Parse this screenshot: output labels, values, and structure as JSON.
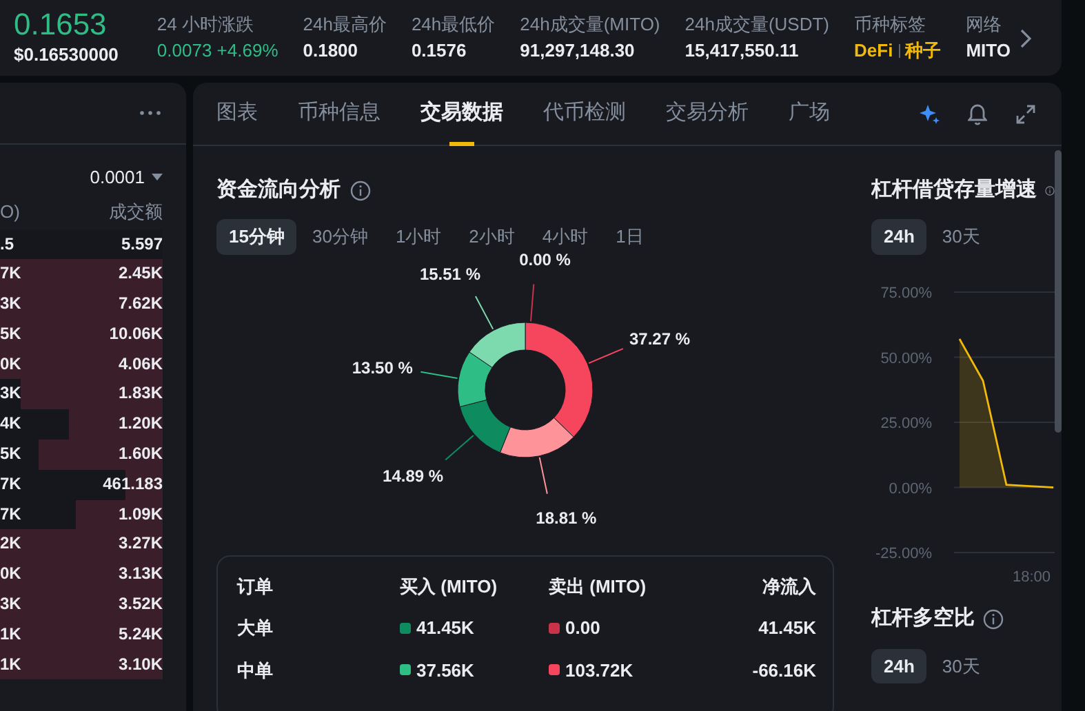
{
  "ticker": {
    "price": "0.1653",
    "price_usd": "$0.16530000"
  },
  "stats": [
    {
      "label": "24 小时涨跌",
      "value": "0.0073 +4.69%",
      "kind": "change"
    },
    {
      "label": "24h最高价",
      "value": "0.1800",
      "kind": "plain"
    },
    {
      "label": "24h最低价",
      "value": "0.1576",
      "kind": "plain"
    },
    {
      "label": "24h成交量(MITO)",
      "value": "91,297,148.30",
      "kind": "plain"
    },
    {
      "label": "24h成交量(USDT)",
      "value": "15,417,550.11",
      "kind": "plain"
    },
    {
      "label": "币种标签",
      "tags": [
        "DeFi",
        "种子"
      ],
      "kind": "tags"
    },
    {
      "label": "网络",
      "value": "MITO",
      "kind": "plain"
    }
  ],
  "order_book": {
    "precision": "0.0001",
    "columns": [
      "O)",
      "成交额"
    ],
    "rows": [
      {
        "amount": ".5",
        "total": "5.597",
        "level": 0
      },
      {
        "amount": "7K",
        "total": "2.45K",
        "level": 1
      },
      {
        "amount": "3K",
        "total": "7.62K",
        "level": 1
      },
      {
        "amount": "5K",
        "total": "10.06K",
        "level": 1
      },
      {
        "amount": "0K",
        "total": "4.06K",
        "level": 1
      },
      {
        "amount": "3K",
        "total": "1.83K",
        "level": 0.87
      },
      {
        "amount": "4K",
        "total": "1.20K",
        "level": 0.58
      },
      {
        "amount": "5K",
        "total": "1.60K",
        "level": 0.76
      },
      {
        "amount": "7K",
        "total": "461.183",
        "level": 0.23
      },
      {
        "amount": "7K",
        "total": "1.09K",
        "level": 0.53
      },
      {
        "amount": "2K",
        "total": "3.27K",
        "level": 1
      },
      {
        "amount": "0K",
        "total": "3.13K",
        "level": 1
      },
      {
        "amount": "3K",
        "total": "3.52K",
        "level": 1
      },
      {
        "amount": "1K",
        "total": "5.24K",
        "level": 1
      },
      {
        "amount": "1K",
        "total": "3.10K",
        "level": 1
      }
    ]
  },
  "tabs": [
    {
      "label": "图表",
      "selected": false
    },
    {
      "label": "币种信息",
      "selected": false
    },
    {
      "label": "交易数据",
      "selected": true
    },
    {
      "label": "代币检测",
      "selected": false
    },
    {
      "label": "交易分析",
      "selected": false
    },
    {
      "label": "广场",
      "selected": false
    }
  ],
  "fund_flow": {
    "title": "资金流向分析",
    "periods": [
      {
        "label": "15分钟",
        "selected": true
      },
      {
        "label": "30分钟",
        "selected": false
      },
      {
        "label": "1小时",
        "selected": false
      },
      {
        "label": "2小时",
        "selected": false
      },
      {
        "label": "4小时",
        "selected": false
      },
      {
        "label": "1日",
        "selected": false
      }
    ],
    "chart_data": {
      "type": "donut",
      "values": [
        0.0,
        37.27,
        18.81,
        14.89,
        13.5,
        15.51
      ],
      "value_labels": [
        "0.00 %",
        "37.27 %",
        "18.81 %",
        "14.89 %",
        "13.50 %",
        "15.51 %"
      ],
      "colors": [
        "#c8334a",
        "#f6465d",
        "#ff939a",
        "#0e8c5f",
        "#2ebd85",
        "#7dd9ae"
      ]
    },
    "table": {
      "columns": [
        "订单",
        "买入 (MITO)",
        "卖出 (MITO)",
        "净流入"
      ],
      "rows": [
        {
          "order": "大单",
          "buy": {
            "value": "41.45K",
            "color": "#0e8c5f"
          },
          "sell": {
            "value": "0.00",
            "color": "#c8334a"
          },
          "net": "41.45K"
        },
        {
          "order": "中单",
          "buy": {
            "value": "37.56K",
            "color": "#2ebd85"
          },
          "sell": {
            "value": "103.72K",
            "color": "#f6465d"
          },
          "net": "-66.16K"
        }
      ]
    }
  },
  "leverage": [
    {
      "title": "杠杆借贷存量增速",
      "periods": [
        {
          "label": "24h",
          "selected": true
        },
        {
          "label": "30天",
          "selected": false
        }
      ],
      "chart_data": {
        "type": "area",
        "series": [
          {
            "color": "#f0b90b",
            "values": [
              57,
              41,
              1,
              0.5,
              0
            ]
          }
        ],
        "ylim": [
          -25,
          75
        ],
        "yticks": [
          {
            "value": 75,
            "label": "75.00%"
          },
          {
            "value": 50,
            "label": "50.00%"
          },
          {
            "value": 25,
            "label": "25.00%"
          },
          {
            "value": 0,
            "label": "0.00%"
          },
          {
            "value": -25,
            "label": "-25.00%"
          }
        ],
        "grid": true,
        "annotations": [
          {
            "text": "18:00"
          }
        ]
      }
    },
    {
      "title": "杠杆多空比",
      "periods": [
        {
          "label": "24h",
          "selected": true
        },
        {
          "label": "30天",
          "selected": false
        }
      ]
    }
  ]
}
